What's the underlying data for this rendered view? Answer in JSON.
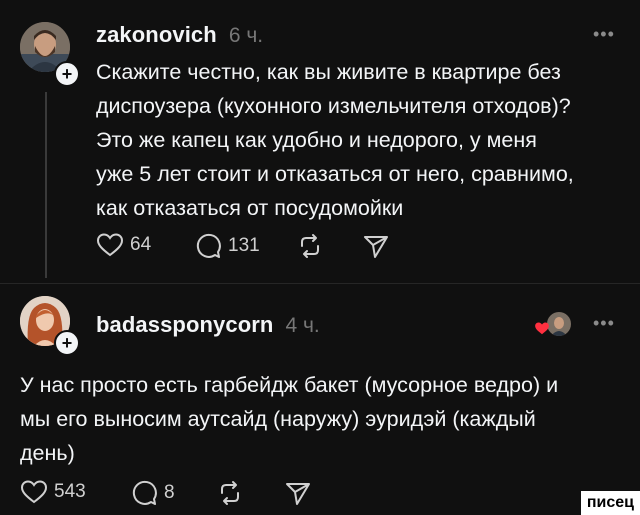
{
  "posts": [
    {
      "username": "zakonovich",
      "time": "6 ч.",
      "more": "•••",
      "lines": [
        "Скажите честно, как вы живите в квартире без",
        "диспоузера (кухонного измельчителя отходов)?",
        "Это же капец как удобно и недорого, у меня",
        "уже 5 лет стоит и отказаться от него, сравнимо,",
        "как отказаться от посудомойки"
      ],
      "likes": "64",
      "replies": "131"
    },
    {
      "username": "badassponycorn",
      "time": "4 ч.",
      "more": "•••",
      "lines": [
        "У нас просто есть гарбейдж бакет (мусорное ведро) и",
        "мы его выносим аутсайд (наружу) эуридэй (каждый",
        "день)"
      ],
      "likes": "543",
      "replies": "8"
    }
  ],
  "follow_symbol": "+",
  "watermark": "писец",
  "colors": {
    "background": "#101010",
    "text": "#f3f5f7",
    "secondary": "#777777",
    "heart_red": "#ff3040"
  },
  "icons": [
    "heart-icon",
    "comment-icon",
    "repost-icon",
    "share-icon",
    "more-icon"
  ]
}
